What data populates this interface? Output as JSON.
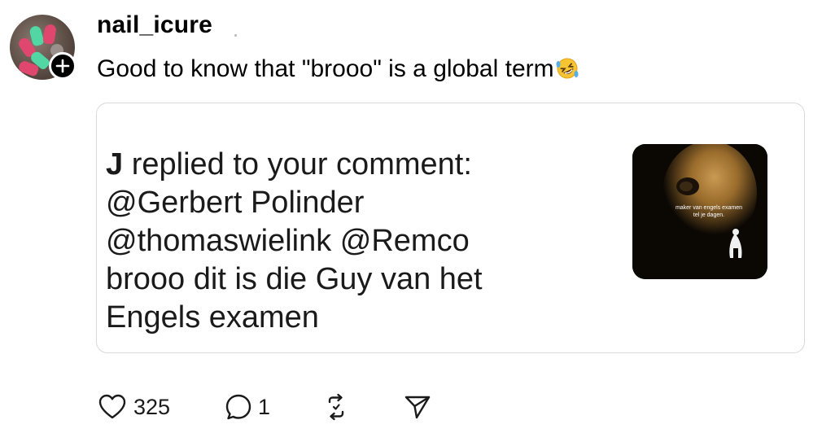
{
  "post": {
    "username": "nail_icure",
    "text": "Good to know that \"brooo\" is a global term",
    "emoji_icon": "rolling-on-floor-laughing-emoji"
  },
  "quoted": {
    "author": "J",
    "line1_rest": " replied to your comment:",
    "line2": "@Gerbert Polinder",
    "line3": "@thomaswielink @Remco",
    "line4": "brooo dit is die Guy van het",
    "line5": "Engels examen",
    "thumb_caption_line1": "maker van engels examen",
    "thumb_caption_line2": "tel je dagen."
  },
  "actions": {
    "likes": "325",
    "replies": "1",
    "like_icon": "heart-icon",
    "reply_icon": "comment-icon",
    "repost_icon": "repost-icon",
    "share_icon": "send-icon"
  },
  "colors": {
    "text": "#000000",
    "border": "#d9d9d9",
    "icon": "#1a1a1a"
  }
}
